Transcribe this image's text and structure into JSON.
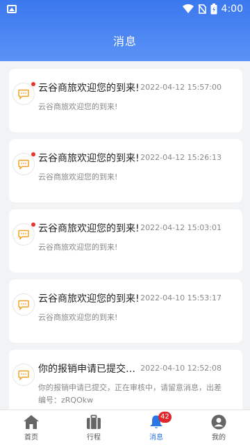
{
  "status": {
    "time": "4:00"
  },
  "header": {
    "title": "消息"
  },
  "messages": [
    {
      "title": "云谷商旅欢迎您的到来!",
      "time": "2022-04-12 15:57:00",
      "summary": "云谷商旅欢迎您的到来!",
      "unread": true
    },
    {
      "title": "云谷商旅欢迎您的到来!",
      "time": "2022-04-12 15:26:13",
      "summary": "云谷商旅欢迎您的到来!",
      "unread": true
    },
    {
      "title": "云谷商旅欢迎您的到来!",
      "time": "2022-04-12 15:03:01",
      "summary": "云谷商旅欢迎您的到来!",
      "unread": true
    },
    {
      "title": "云谷商旅欢迎您的到来!",
      "time": "2022-04-10 15:53:17",
      "summary": "云谷商旅欢迎您的到来!",
      "unread": false
    },
    {
      "title": "你的报销申请已提交，正在审核中",
      "time": "2022-04-10 12:52:08",
      "summary": "你的报销申请已提交，正在审核中，请留意消息，出差编号：zRQOkw",
      "unread": false
    }
  ],
  "tabs": [
    {
      "label": "首页",
      "icon": "home-icon"
    },
    {
      "label": "行程",
      "icon": "suitcase-icon"
    },
    {
      "label": "消息",
      "icon": "bell-icon",
      "badge": "42",
      "active": true
    },
    {
      "label": "我的",
      "icon": "user-icon"
    }
  ],
  "colors": {
    "accent": "#2b76e6",
    "header": "#4a86f2",
    "badge": "#e0262b",
    "unread_dot": "#e8322b",
    "message_icon": "#f0a020"
  }
}
